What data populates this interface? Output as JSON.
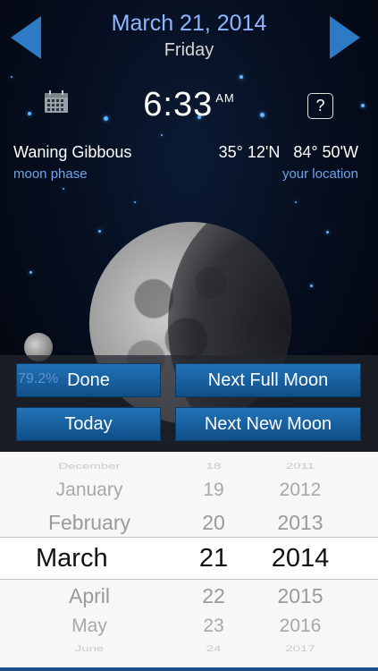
{
  "header": {
    "date": "March 21, 2014",
    "weekday": "Friday"
  },
  "clock": {
    "time": "6:33",
    "ampm": "AM"
  },
  "help": {
    "label": "?"
  },
  "moon_info": {
    "phase": "Waning Gibbous",
    "phase_caption": "moon phase",
    "coordinates": "35° 12'N   84° 50'W",
    "location_caption": "your location",
    "illumination": "79.2%"
  },
  "buttons": {
    "done": "Done",
    "today": "Today",
    "next_full": "Next Full Moon",
    "next_new": "Next New Moon"
  },
  "picker": {
    "months": [
      "December",
      "January",
      "February",
      "March",
      "April",
      "May",
      "June"
    ],
    "days": [
      "18",
      "19",
      "20",
      "21",
      "22",
      "23",
      "24"
    ],
    "years": [
      "2011",
      "2012",
      "2013",
      "2014",
      "2015",
      "2016",
      "2017"
    ]
  },
  "colors": {
    "accent": "#2d7bc4",
    "date_title": "#8fb6ff",
    "caption": "#6fa5e8"
  }
}
